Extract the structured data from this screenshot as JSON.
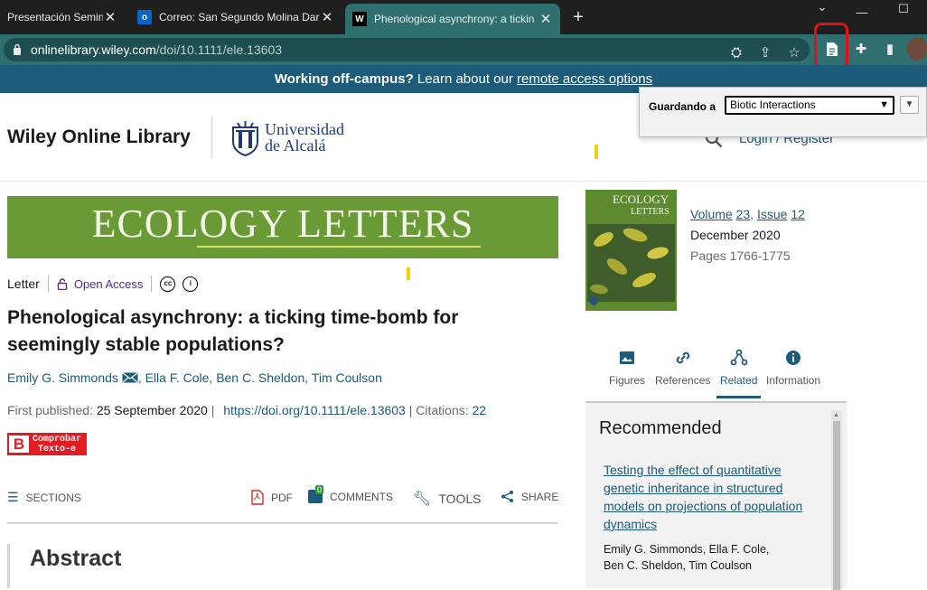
{
  "browser": {
    "tabs": [
      {
        "title": "Presentación Seminar",
        "icon": "",
        "active": false
      },
      {
        "title": "Correo: San Segundo Molina Dar",
        "icon": "o",
        "active": false
      },
      {
        "title": "Phenological asynchrony: a tickin",
        "icon": "W",
        "active": true
      }
    ],
    "url_domain": "onlinelibrary.wiley.com",
    "url_path": "/doi/10.1111/ele.13603",
    "colors": {
      "tabbar": "#1f1f1f",
      "active_tab": "#2f6f70",
      "highlight_box": "#e0101f"
    }
  },
  "banner": {
    "bold": "Working off-campus?",
    "text": " Learn about our ",
    "link": "remote access options"
  },
  "header": {
    "site_title": "Wiley Online Library",
    "institution_line1": "Universidad",
    "institution_line2": "de Alcalá",
    "login": "Login / Register"
  },
  "save_popup": {
    "label": "Guardando a",
    "selected": "Biotic Interactions"
  },
  "journal": {
    "banner_title": "ECOLOGY LETTERS",
    "cover_title1": "ECOLOGY",
    "cover_title2": "LETTERS"
  },
  "article": {
    "type": "Letter",
    "open_access": "Open Access",
    "title": "Phenological asynchrony: a ticking time-bomb for seemingly stable populations?",
    "authors": [
      "Emily G. Simmonds",
      "Ella F. Cole",
      "Ben C. Sheldon",
      "Tim Coulson"
    ],
    "first_published_label": "First published:",
    "first_published": "25 September 2020",
    "doi": "https://doi.org/10.1111/ele.13603",
    "citations_label": "Citations:",
    "citations": "22",
    "comprobar_line1": "Comprobar",
    "comprobar_line2": "Texto-e"
  },
  "toolbar": {
    "sections": "SECTIONS",
    "pdf": "PDF",
    "comments": "COMMENTS",
    "comments_count": "0",
    "tools": "TOOLS",
    "share": "SHARE"
  },
  "abstract_heading": "Abstract",
  "issue": {
    "volume_label": "Volume",
    "volume_num": "23",
    "issue_label": "Issue",
    "issue_num": "12",
    "date": "December 2020",
    "pages": "Pages 1766-1775"
  },
  "right_tabs": [
    "Figures",
    "References",
    "Related",
    "Information"
  ],
  "recommended": {
    "heading": "Recommended",
    "link": "Testing the effect of quantitative genetic inheritance in structured models on projections of population dynamics",
    "authors_line1": "Emily G. Simmonds, Ella F. Cole,",
    "authors_line2": "Ben C. Sheldon, Tim Coulson"
  }
}
